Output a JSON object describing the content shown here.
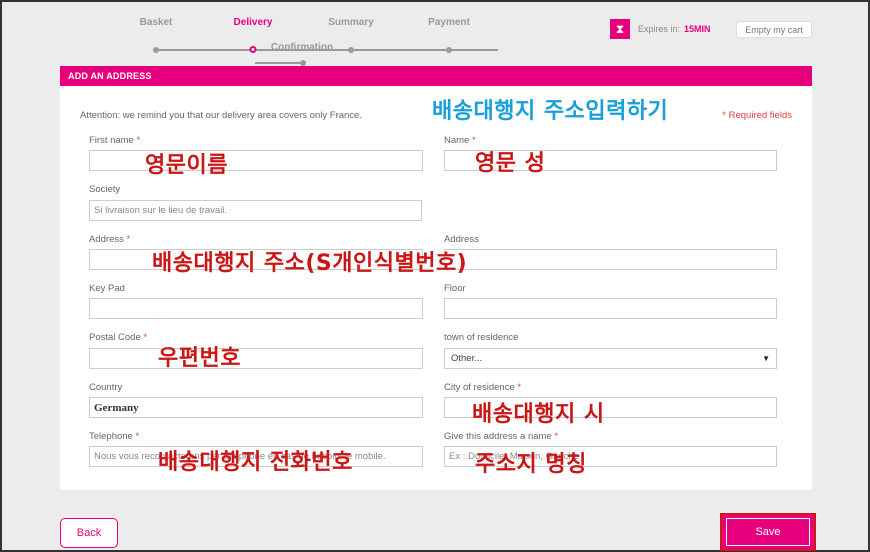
{
  "steps": [
    {
      "label": "Basket",
      "active": false
    },
    {
      "label": "Delivery",
      "active": true
    },
    {
      "label": "Summary",
      "active": false
    },
    {
      "label": "Payment",
      "active": false
    }
  ],
  "sub_step": {
    "label": "Confirmation"
  },
  "timer": {
    "label": "Expires in:",
    "value": "15MIN",
    "icon": "hourglass-icon"
  },
  "empty_cart_label": "Empty my cart",
  "section_title": "ADD AN ADDRESS",
  "attention": "Attention: we remind you that our delivery area covers only France.",
  "required_note": "* Required fields",
  "fields": {
    "first_name": {
      "label": "First name",
      "required": "*",
      "value": ""
    },
    "name": {
      "label": "Name",
      "required": "*",
      "value": ""
    },
    "society": {
      "label": "Society",
      "placeholder": "Si livraison sur le lieu de travail."
    },
    "address": {
      "label": "Address",
      "required": "*",
      "value": ""
    },
    "address2": {
      "label": "Address",
      "value": ""
    },
    "key_pad": {
      "label": "Key Pad",
      "value": ""
    },
    "floor": {
      "label": "Floor",
      "value": ""
    },
    "postal_code": {
      "label": "Postal Code",
      "required": "*",
      "value": ""
    },
    "town": {
      "label": "town of residence",
      "selected": "Other..."
    },
    "country": {
      "label": "Country",
      "value": "Germany"
    },
    "city": {
      "label": "City of residence",
      "required": "*",
      "value": ""
    },
    "telephone": {
      "label": "Telephone",
      "required": "*",
      "placeholder": "Nous vous recontacterons par téléphone en cas de besoin, le mobile."
    },
    "address_name": {
      "label": "Give this address a name",
      "required": "*",
      "placeholder": "Ex : Domicile, Maison, Gauche"
    }
  },
  "annotations": {
    "title": "배송대행지  주소입력하기",
    "first_name": "영문이름",
    "last_name": "영문 성",
    "address": "배송대행지 주소(S개인식별번호)",
    "postal": "우편번호",
    "city": "배송대행지 시",
    "phone": "배송대행지 전화번호",
    "address_name": "주소지 명칭"
  },
  "buttons": {
    "back": "Back",
    "save": "Save"
  },
  "colors": {
    "accent": "#e6007e",
    "annotation_red": "#cc1515",
    "annotation_blue": "#1aa0d8"
  }
}
